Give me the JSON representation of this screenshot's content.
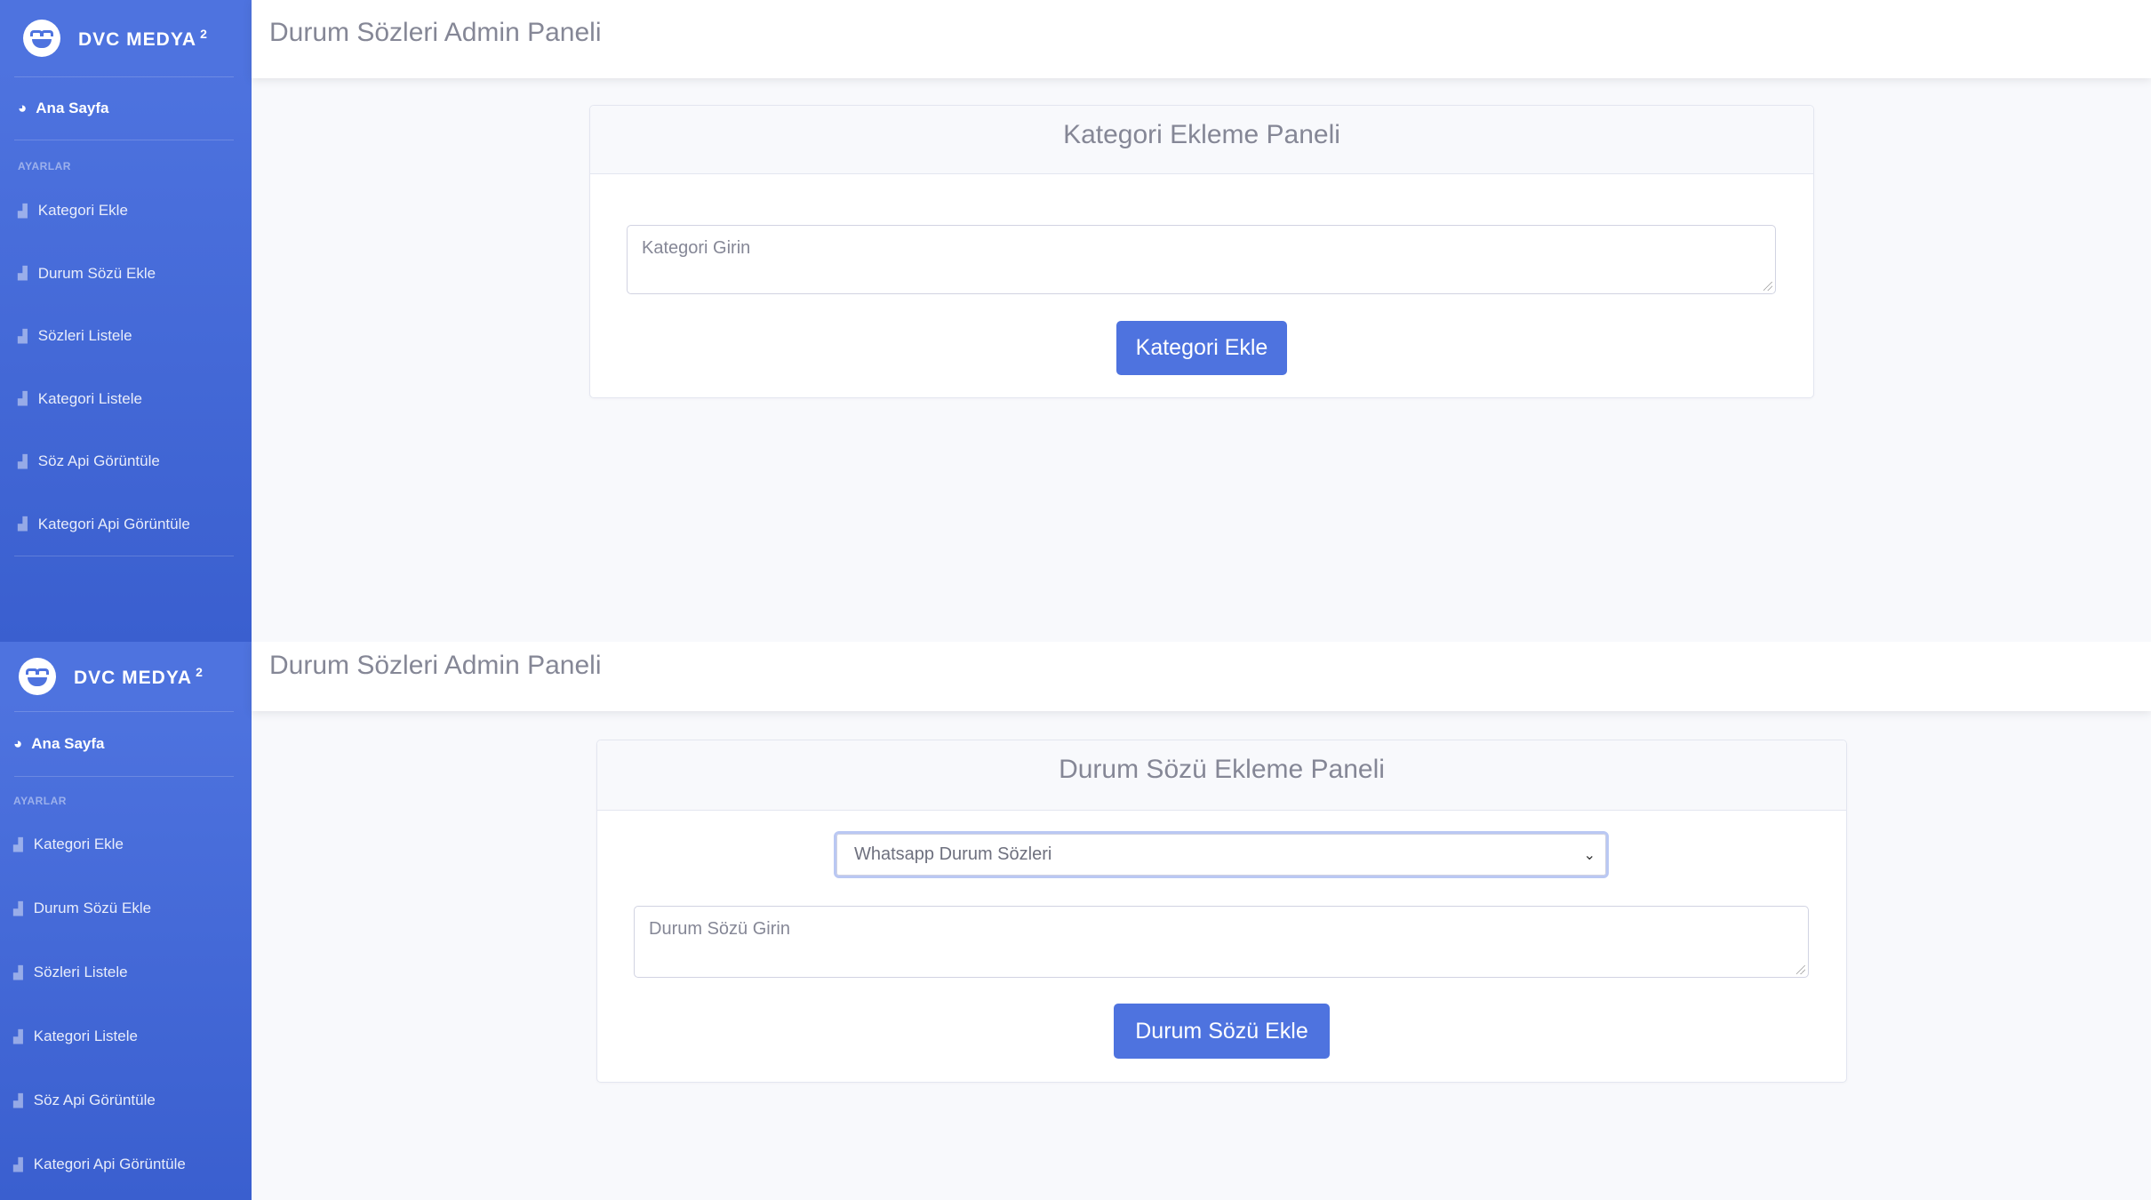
{
  "sidebar": {
    "brand": "DVC MEDYA",
    "brand_sup": "2",
    "home": "Ana Sayfa",
    "heading": "AYARLAR",
    "items": [
      {
        "label": "Kategori Ekle"
      },
      {
        "label": "Durum Sözü Ekle"
      },
      {
        "label": "Sözleri Listele"
      },
      {
        "label": "Kategori Listele"
      },
      {
        "label": "Söz Api Görüntüle"
      },
      {
        "label": "Kategori Api Görüntüle"
      }
    ]
  },
  "topbar": {
    "title": "Durum Sözleri Admin Paneli"
  },
  "category_panel": {
    "title": "Kategori Ekleme Paneli",
    "placeholder": "Kategori Girin",
    "button": "Kategori Ekle"
  },
  "quote_panel": {
    "title": "Durum Sözü Ekleme Paneli",
    "selected_category": "Whatsapp Durum Sözleri",
    "placeholder": "Durum Sözü Girin",
    "button": "Durum Sözü Ekle"
  },
  "colors": {
    "primary": "#4e73df",
    "background": "#f8f9fc",
    "muted_text": "#858796"
  },
  "icons": {
    "brand": "grin-icon",
    "home": "tachometer-icon",
    "nav": "chart-area-icon"
  }
}
